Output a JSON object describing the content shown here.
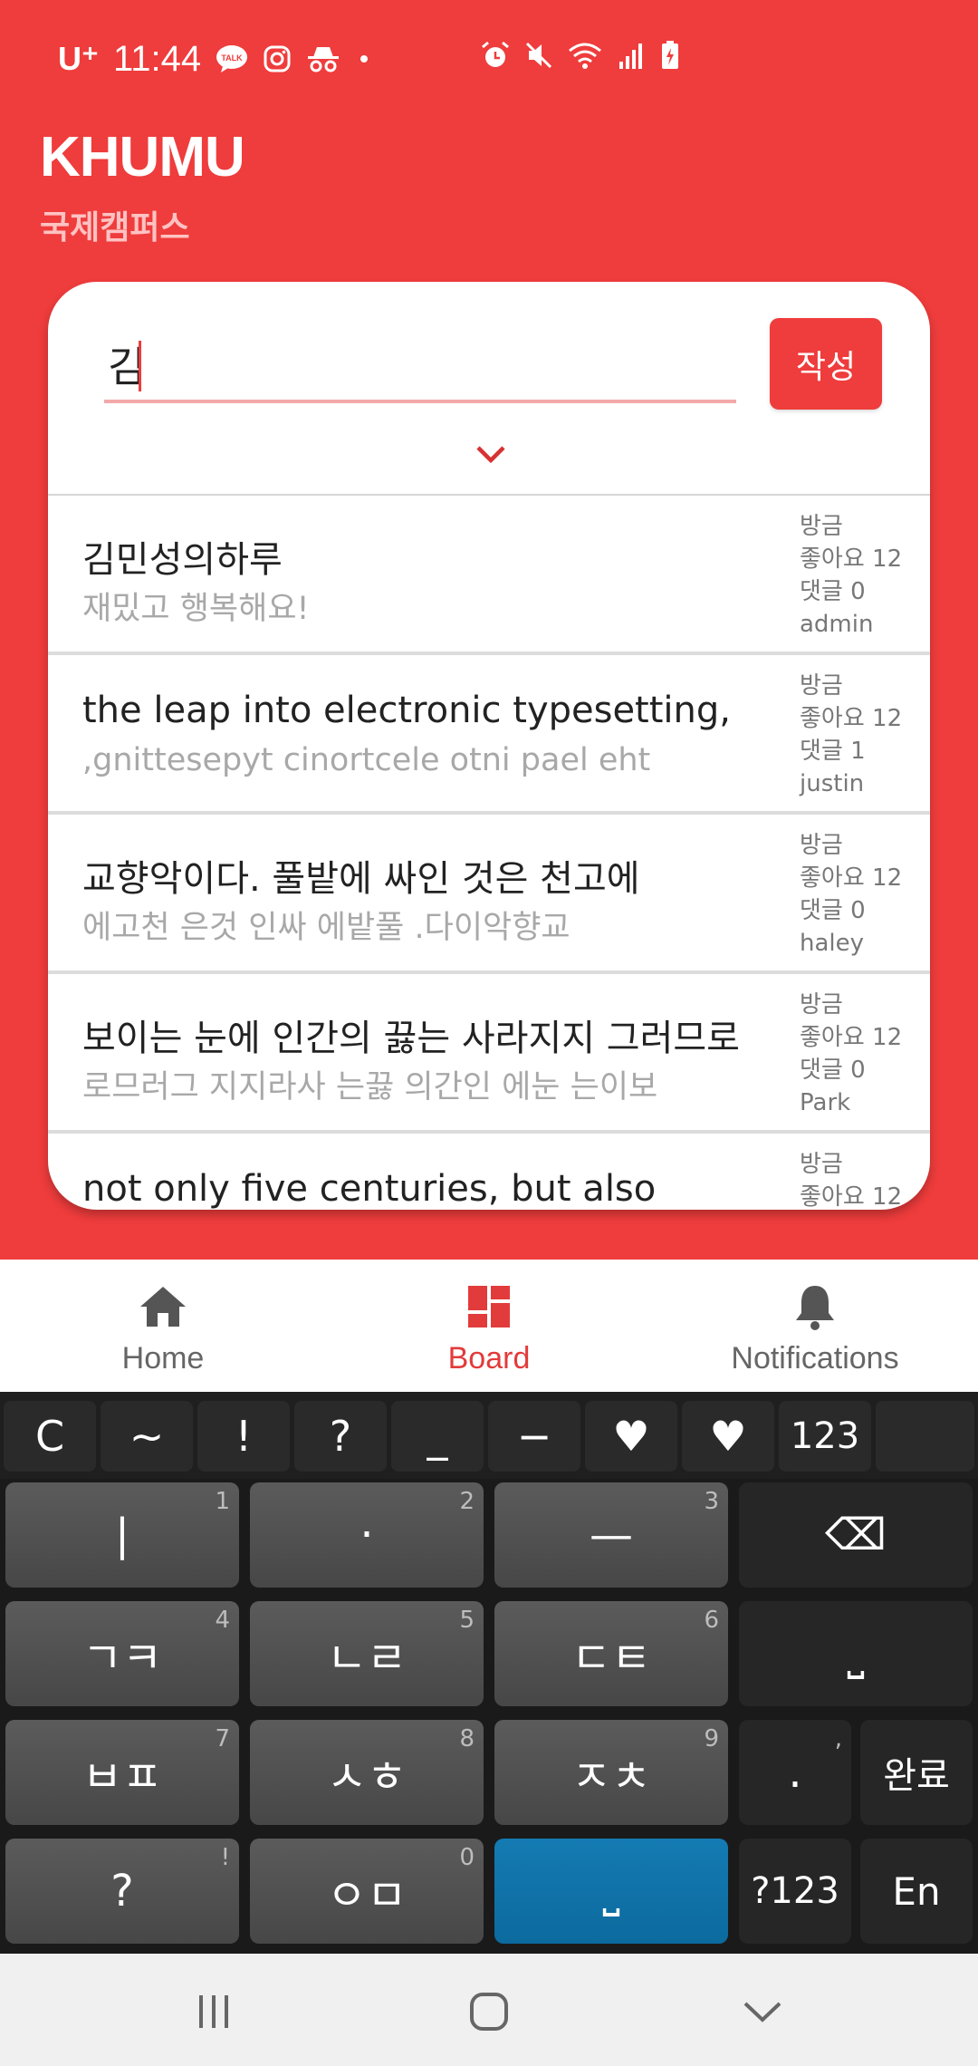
{
  "status_bar": {
    "carrier": "U⁺",
    "time": "11:44",
    "icons": [
      "talk-icon",
      "instagram-icon",
      "incognito-icon",
      "dot-icon",
      "alarm-icon",
      "mute-icon",
      "wifi-icon",
      "signal-icon",
      "battery-icon"
    ]
  },
  "header": {
    "title": "KHUMU",
    "subtitle": "국제캠퍼스"
  },
  "search": {
    "value": "김",
    "write_button": "작성"
  },
  "posts": [
    {
      "title": "김민성의하루",
      "preview": "재밌고 행복해요!",
      "time": "방금",
      "likes": "좋아요 12",
      "comments": "댓글 0",
      "author": "admin"
    },
    {
      "title": "the leap into electronic typesetting,",
      "preview": ",gnittesepyt cinortcele otni pael eht",
      "time": "방금",
      "likes": "좋아요 12",
      "comments": "댓글 1",
      "author": "justin"
    },
    {
      "title": "교향악이다. 풀밭에 싸인 것은 천고에",
      "preview": "에고천 은것 인싸 에밭풀 .다이악향교",
      "time": "방금",
      "likes": "좋아요 12",
      "comments": "댓글 0",
      "author": "haley"
    },
    {
      "title": "보이는 눈에 인간의 끓는 사라지지 그러므로",
      "preview": "로므러그 지지라사 는끓 의간인 에눈 는이보",
      "time": "방금",
      "likes": "좋아요 12",
      "comments": "댓글 0",
      "author": "Park"
    },
    {
      "title": "not only five centuries, but also",
      "preview": "",
      "time": "방금",
      "likes": "좋아요 12",
      "comments": "",
      "author": ""
    }
  ],
  "bottom_nav": {
    "home": "Home",
    "board": "Board",
    "notifications": "Notifications",
    "active": "board",
    "active_color": "#e23b3b"
  },
  "keyboard": {
    "symbols": [
      "C",
      "~",
      "!",
      "?",
      "_",
      "−",
      "♥",
      "♥",
      "123"
    ],
    "rows": [
      [
        {
          "label": "|",
          "num": "1"
        },
        {
          "label": "·",
          "num": "2"
        },
        {
          "label": "—",
          "num": "3"
        },
        {
          "label": "⌫",
          "num": ""
        }
      ],
      [
        {
          "label": "ㄱㅋ",
          "num": "4"
        },
        {
          "label": "ㄴㄹ",
          "num": "5"
        },
        {
          "label": "ㄷㅌ",
          "num": "6"
        },
        {
          "label": "⎵",
          "num": ""
        }
      ],
      [
        {
          "label": "ㅂㅍ",
          "num": "7"
        },
        {
          "label": "ㅅㅎ",
          "num": "8"
        },
        {
          "label": "ㅈㅊ",
          "num": "9"
        },
        {
          "label": ".",
          "num": ","
        },
        {
          "label": "완료",
          "num": ""
        }
      ],
      [
        {
          "label": "?",
          "num": "!"
        },
        {
          "label": "ㅇㅁ",
          "num": "0"
        },
        {
          "label": "⎵",
          "num": ""
        },
        {
          "label": "?123",
          "num": ""
        },
        {
          "label": "En",
          "num": ""
        }
      ]
    ]
  },
  "colors": {
    "brand": "#ef3c3c",
    "subtitle": "#ffc2c2"
  }
}
